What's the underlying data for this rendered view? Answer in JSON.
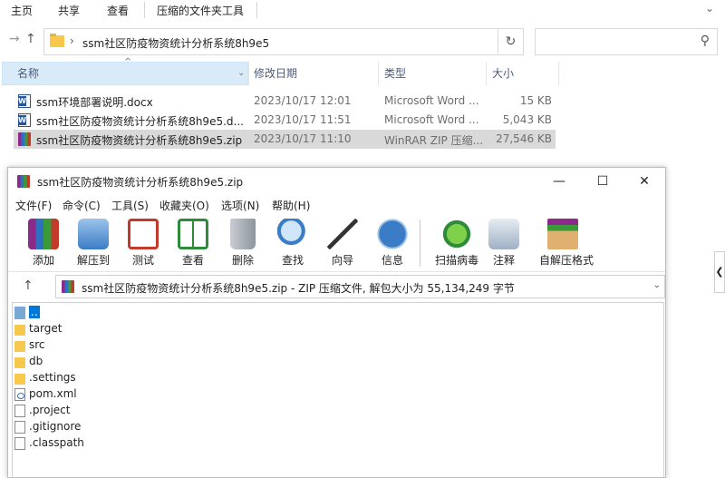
{
  "explorer": {
    "ribbon_tabs": [
      "主页",
      "共享",
      "查看",
      "压缩的文件夹工具"
    ],
    "address_path": "ssm社区防疫物资统计分析系统8h9e5",
    "columns": {
      "name": "名称",
      "modified": "修改日期",
      "type": "类型",
      "size": "大小"
    },
    "files": [
      {
        "name": "ssm环境部署说明.docx",
        "modified": "2023/10/17 12:01",
        "type": "Microsoft Word ...",
        "size": "15 KB",
        "icon": "word-doc-icon"
      },
      {
        "name": "ssm社区防疫物资统计分析系统8h9e5.d...",
        "modified": "2023/10/17 11:51",
        "type": "Microsoft Word ...",
        "size": "5,043 KB",
        "icon": "word-doc-icon"
      },
      {
        "name": "ssm社区防疫物资统计分析系统8h9e5.zip",
        "modified": "2023/10/17 11:10",
        "type": "WinRAR ZIP 压缩...",
        "size": "27,546 KB",
        "icon": "winrar-archive-icon",
        "selected": true
      }
    ]
  },
  "winrar": {
    "title": "ssm社区防疫物资统计分析系统8h9e5.zip",
    "menu": [
      "文件(F)",
      "命令(C)",
      "工具(S)",
      "收藏夹(O)",
      "选项(N)",
      "帮助(H)"
    ],
    "toolbar": [
      {
        "label": "添加",
        "icon": "add-archive-icon"
      },
      {
        "label": "解压到",
        "icon": "extract-to-icon"
      },
      {
        "label": "测试",
        "icon": "test-icon"
      },
      {
        "label": "查看",
        "icon": "view-icon"
      },
      {
        "label": "删除",
        "icon": "delete-icon"
      },
      {
        "label": "查找",
        "icon": "find-icon"
      },
      {
        "label": "向导",
        "icon": "wizard-icon"
      },
      {
        "label": "信息",
        "icon": "info-icon"
      },
      {
        "label": "扫描病毒",
        "icon": "virus-scan-icon"
      },
      {
        "label": "注释",
        "icon": "comment-icon"
      },
      {
        "label": "自解压格式",
        "icon": "sfx-icon"
      }
    ],
    "path_text": "ssm社区防疫物资统计分析系统8h9e5.zip - ZIP 压缩文件, 解包大小为 55,134,249 字节",
    "items": [
      {
        "name": "..",
        "kind": "up"
      },
      {
        "name": "target",
        "kind": "folder"
      },
      {
        "name": "src",
        "kind": "folder"
      },
      {
        "name": "db",
        "kind": "folder"
      },
      {
        "name": ".settings",
        "kind": "folder"
      },
      {
        "name": "pom.xml",
        "kind": "xml"
      },
      {
        "name": ".project",
        "kind": "file"
      },
      {
        "name": ".gitignore",
        "kind": "file"
      },
      {
        "name": ".classpath",
        "kind": "file"
      }
    ]
  }
}
